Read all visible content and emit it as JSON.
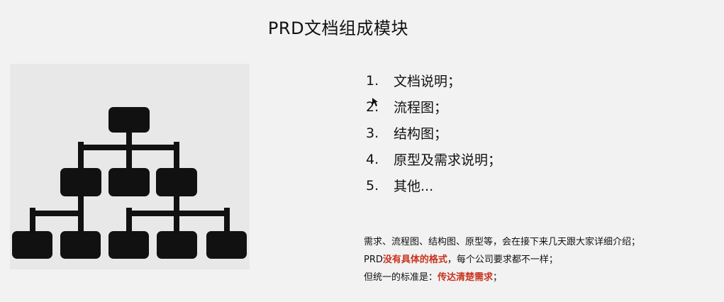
{
  "slide": {
    "title": "PRD文档组成模块",
    "icon": "organization-chart-icon",
    "outline": [
      {
        "number": "1.",
        "text": "文档说明；"
      },
      {
        "number": "2.",
        "text": "流程图；"
      },
      {
        "number": "3.",
        "text": "结构图；"
      },
      {
        "number": "4.",
        "text": "原型及需求说明；"
      },
      {
        "number": "5.",
        "text": "其他..."
      }
    ],
    "notes": {
      "line1": "需求、流程图、结构图、原型等，会在接下来几天跟大家详细介绍；",
      "line2_prefix": "PRD",
      "line2_highlight": "没有具体的格式",
      "line2_suffix": "，每个公司要求都不一样；",
      "line3_prefix": "但统一的标准是：",
      "line3_highlight": "传达清楚需求",
      "line3_suffix": "；"
    },
    "colors": {
      "background": "#f2f2f2",
      "panel": "#e8e8e8",
      "diagram": "#111111",
      "highlight": "#c8321e"
    }
  }
}
